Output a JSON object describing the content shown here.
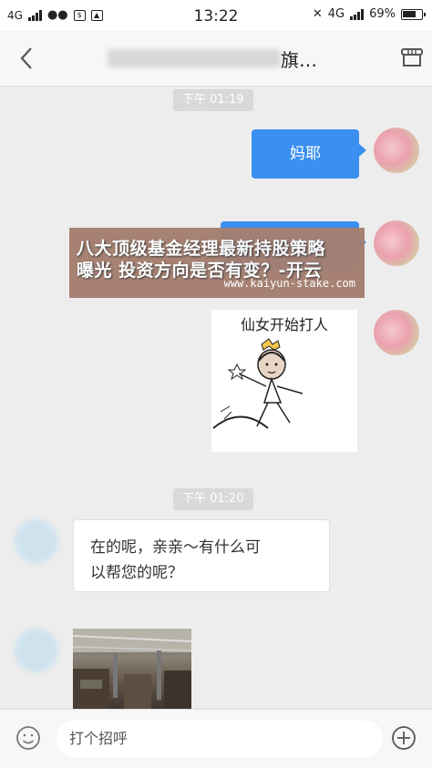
{
  "status_bar": {
    "network_left": "4G",
    "time": "13:22",
    "network_right": "4G",
    "battery": "69%"
  },
  "header": {
    "title_visible": "旗…",
    "back_icon": "chevron-left-icon",
    "shop_icon": "storefront-icon"
  },
  "chat": {
    "timestamps": [
      "下午 01:19",
      "下午 01:20"
    ],
    "my_message_1": "妈耶",
    "sticker_caption": "仙女开始打人",
    "their_message_1": "在的呢，亲亲～有什么可以帮您的呢？",
    "their_message_lines": [
      "在的呢，亲亲～有什么可",
      "以帮您的呢？"
    ]
  },
  "overlay": {
    "line1": "八大顶级基金经理最新持股策略",
    "line2": "曝光  投资方向是否有变？-开云",
    "url": "www.kaiyun-stake.com"
  },
  "input_bar": {
    "placeholder": "打个招呼",
    "emoji_icon": "smiley-icon",
    "plus_icon": "plus-circle-icon"
  },
  "colors": {
    "accent": "#3a8ff0",
    "overlay_bg": "#a57f70"
  }
}
